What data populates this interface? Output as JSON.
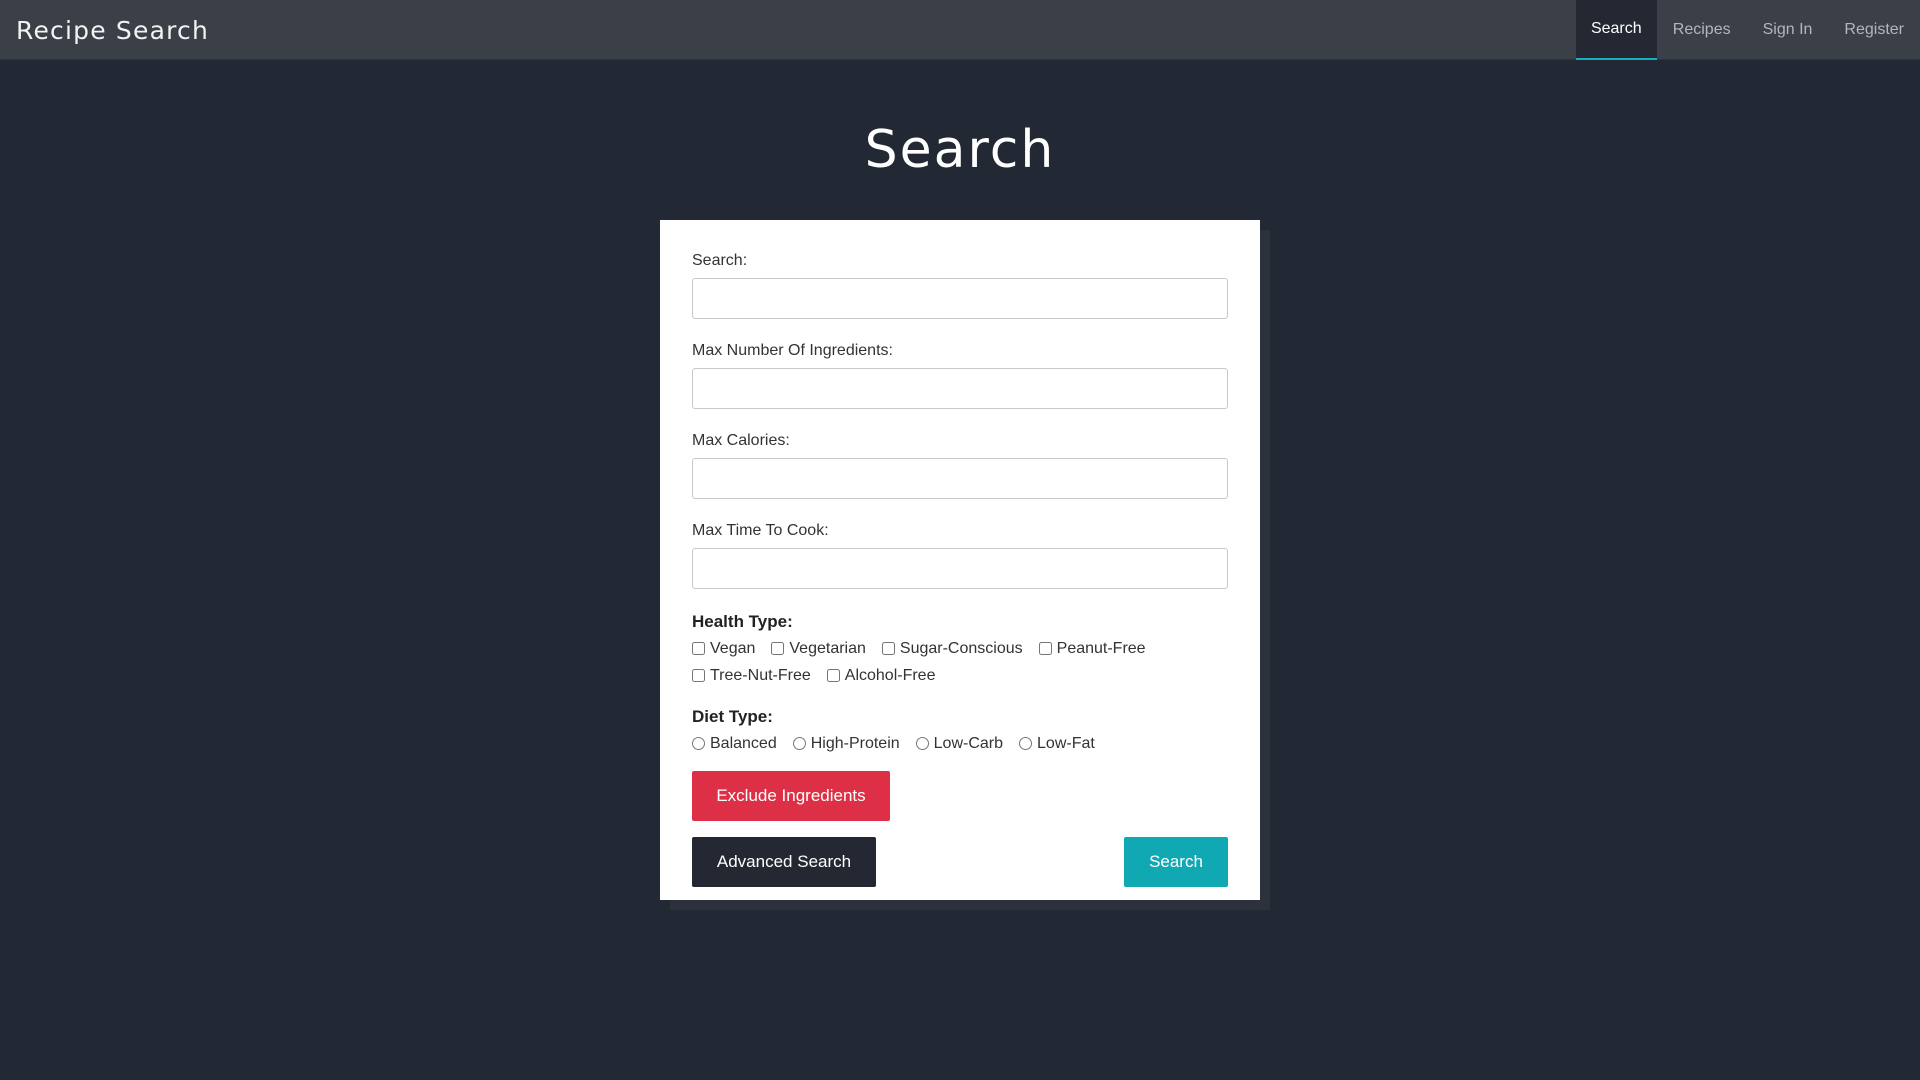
{
  "app": {
    "brand": "Recipe Search"
  },
  "nav": {
    "items": [
      {
        "label": "Search",
        "active": true
      },
      {
        "label": "Recipes"
      },
      {
        "label": "Sign In"
      },
      {
        "label": "Register"
      }
    ]
  },
  "page": {
    "title": "Search"
  },
  "form": {
    "search": {
      "label": "Search:",
      "value": "",
      "placeholder": ""
    },
    "max_ingredients": {
      "label": "Max Number Of Ingredients:",
      "value": "",
      "placeholder": ""
    },
    "max_calories": {
      "label": "Max Calories:",
      "value": "",
      "placeholder": ""
    },
    "max_time": {
      "label": "Max Time To Cook:",
      "value": "",
      "placeholder": ""
    },
    "health": {
      "title": "Health Type:",
      "options": [
        "Vegan",
        "Vegetarian",
        "Sugar-Conscious",
        "Peanut-Free",
        "Tree-Nut-Free",
        "Alcohol-Free"
      ]
    },
    "diet": {
      "title": "Diet Type:",
      "options": [
        "Balanced",
        "High-Protein",
        "Low-Carb",
        "Low-Fat"
      ]
    },
    "buttons": {
      "exclude": "Exclude Ingredients",
      "advanced": "Advanced Search",
      "search": "Search"
    }
  },
  "colors": {
    "background": "#222834",
    "navbar": "#3b3f48",
    "accent": "#16b2c2",
    "danger": "#dd3046",
    "dark": "#232833",
    "primary": "#10a8b3"
  }
}
